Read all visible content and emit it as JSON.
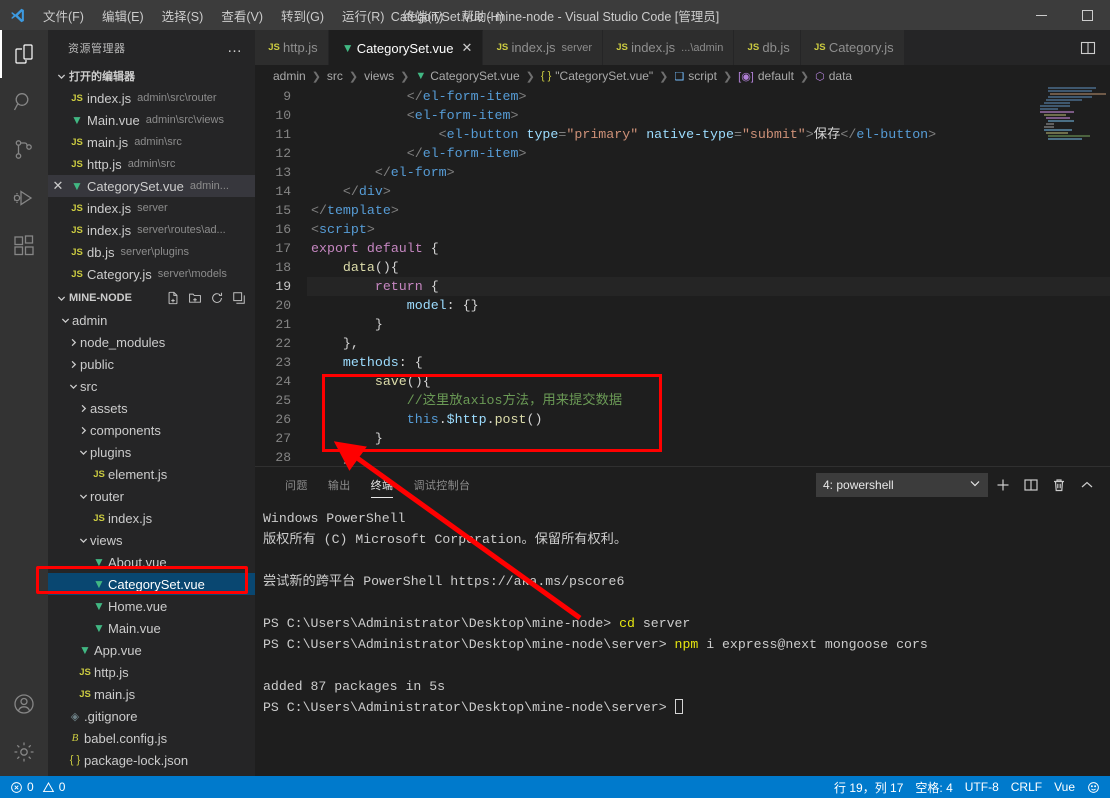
{
  "titlebar": {
    "title": "CategorySet.vue - mine-node - Visual Studio Code [管理员]",
    "menus": [
      {
        "label": "文件(F)",
        "name": "menu-file"
      },
      {
        "label": "编辑(E)",
        "name": "menu-edit"
      },
      {
        "label": "选择(S)",
        "name": "menu-selection"
      },
      {
        "label": "查看(V)",
        "name": "menu-view"
      },
      {
        "label": "转到(G)",
        "name": "menu-goto"
      },
      {
        "label": "运行(R)",
        "name": "menu-run"
      },
      {
        "label": "终端(T)",
        "name": "menu-terminal"
      },
      {
        "label": "帮助(H)",
        "name": "menu-help"
      }
    ],
    "minimize": "—",
    "maximize": "□"
  },
  "activitybar": {
    "items": [
      {
        "name": "explorer-icon",
        "active": true
      },
      {
        "name": "search-icon",
        "active": false
      },
      {
        "name": "source-control-icon",
        "active": false
      },
      {
        "name": "run-debug-icon",
        "active": false
      },
      {
        "name": "extensions-icon",
        "active": false
      }
    ],
    "bottom": [
      {
        "name": "account-icon"
      },
      {
        "name": "settings-gear-icon"
      }
    ]
  },
  "sidebar": {
    "title": "资源管理器",
    "more_label": "…",
    "open_editors": {
      "label": "打开的编辑器",
      "items": [
        {
          "icon": "js",
          "name": "index.js",
          "desc": "admin\\src\\router",
          "active": false
        },
        {
          "icon": "vue",
          "name": "Main.vue",
          "desc": "admin\\src\\views",
          "active": false
        },
        {
          "icon": "js",
          "name": "main.js",
          "desc": "admin\\src",
          "active": false
        },
        {
          "icon": "js",
          "name": "http.js",
          "desc": "admin\\src",
          "active": false
        },
        {
          "icon": "vue",
          "name": "CategorySet.vue",
          "desc": "admin...",
          "active": true
        },
        {
          "icon": "js",
          "name": "index.js",
          "desc": "server",
          "active": false
        },
        {
          "icon": "js",
          "name": "index.js",
          "desc": "server\\routes\\ad...",
          "active": false
        },
        {
          "icon": "js",
          "name": "db.js",
          "desc": "server\\plugins",
          "active": false
        },
        {
          "icon": "js",
          "name": "Category.js",
          "desc": "server\\models",
          "active": false
        }
      ]
    },
    "project": {
      "label": "MINE-NODE",
      "actions": [
        "new-file-icon",
        "new-folder-icon",
        "refresh-icon",
        "collapse-all-icon"
      ],
      "tree": [
        {
          "label": "admin",
          "type": "folder",
          "expanded": true,
          "depth": 1
        },
        {
          "label": "node_modules",
          "type": "folder",
          "expanded": false,
          "depth": 2
        },
        {
          "label": "public",
          "type": "folder",
          "expanded": false,
          "depth": 2
        },
        {
          "label": "src",
          "type": "folder",
          "expanded": true,
          "depth": 2
        },
        {
          "label": "assets",
          "type": "folder",
          "expanded": false,
          "depth": 3
        },
        {
          "label": "components",
          "type": "folder",
          "expanded": false,
          "depth": 3
        },
        {
          "label": "plugins",
          "type": "folder",
          "expanded": true,
          "depth": 3
        },
        {
          "label": "element.js",
          "type": "js",
          "depth": 4
        },
        {
          "label": "router",
          "type": "folder",
          "expanded": true,
          "depth": 3
        },
        {
          "label": "index.js",
          "type": "js",
          "depth": 4
        },
        {
          "label": "views",
          "type": "folder",
          "expanded": true,
          "depth": 3
        },
        {
          "label": "About.vue",
          "type": "vue",
          "depth": 4
        },
        {
          "label": "CategorySet.vue",
          "type": "vue",
          "depth": 4,
          "selected": true
        },
        {
          "label": "Home.vue",
          "type": "vue",
          "depth": 4
        },
        {
          "label": "Main.vue",
          "type": "vue",
          "depth": 4
        },
        {
          "label": "App.vue",
          "type": "vue",
          "depth": 3
        },
        {
          "label": "http.js",
          "type": "js",
          "depth": 3
        },
        {
          "label": "main.js",
          "type": "js",
          "depth": 3
        },
        {
          "label": ".gitignore",
          "type": "git",
          "depth": 2
        },
        {
          "label": "babel.config.js",
          "type": "babel",
          "depth": 2
        },
        {
          "label": "package-lock.json",
          "type": "json",
          "depth": 2
        }
      ]
    }
  },
  "tabs": [
    {
      "icon": "js",
      "label": "http.js",
      "desc": "",
      "active": false,
      "closable": false
    },
    {
      "icon": "vue",
      "label": "CategorySet.vue",
      "desc": "",
      "active": true,
      "closable": true
    },
    {
      "icon": "js",
      "label": "index.js",
      "desc": "server",
      "active": false,
      "closable": false
    },
    {
      "icon": "js",
      "label": "index.js",
      "desc": "...\\admin",
      "active": false,
      "closable": false
    },
    {
      "icon": "js",
      "label": "db.js",
      "desc": "",
      "active": false,
      "closable": false
    },
    {
      "icon": "js",
      "label": "Category.js",
      "desc": "",
      "active": false,
      "closable": false
    }
  ],
  "tabs_actions": [
    {
      "name": "split-editor-icon"
    }
  ],
  "breadcrumbs": [
    {
      "label": "admin",
      "icon": ""
    },
    {
      "label": "src",
      "icon": ""
    },
    {
      "label": "views",
      "icon": ""
    },
    {
      "label": "CategorySet.vue",
      "icon": "vue"
    },
    {
      "label": "\"CategorySet.vue\"",
      "icon": "{}"
    },
    {
      "label": "script",
      "icon": "module"
    },
    {
      "label": "default",
      "icon": "[@]"
    },
    {
      "label": "data",
      "icon": "field"
    }
  ],
  "editor": {
    "first_line": 9,
    "cursor_line": 19,
    "lines": [
      {
        "n": 9,
        "text": "            </el-form-item>"
      },
      {
        "n": 10,
        "text": "            <el-form-item>"
      },
      {
        "n": 11,
        "text": "                <el-button type=\"primary\" native-type=\"submit\">保存</el-button>"
      },
      {
        "n": 12,
        "text": "            </el-form-item>"
      },
      {
        "n": 13,
        "text": "        </el-form>"
      },
      {
        "n": 14,
        "text": "    </div>"
      },
      {
        "n": 15,
        "text": "</template>"
      },
      {
        "n": 16,
        "text": "<script>"
      },
      {
        "n": 17,
        "text": "export default {"
      },
      {
        "n": 18,
        "text": "    data(){"
      },
      {
        "n": 19,
        "text": "        return {"
      },
      {
        "n": 20,
        "text": "            model: {}"
      },
      {
        "n": 21,
        "text": "        }"
      },
      {
        "n": 22,
        "text": "    },"
      },
      {
        "n": 23,
        "text": "    methods: {"
      },
      {
        "n": 24,
        "text": "        save(){"
      },
      {
        "n": 25,
        "text": "            //这里放axios方法，用来提交数据"
      },
      {
        "n": 26,
        "text": "            this.$http.post()"
      },
      {
        "n": 27,
        "text": "        }"
      },
      {
        "n": 28,
        "text": "    }"
      }
    ]
  },
  "panel": {
    "tabs": [
      {
        "label": "问题",
        "active": false
      },
      {
        "label": "输出",
        "active": false
      },
      {
        "label": "终端",
        "active": true
      },
      {
        "label": "调试控制台",
        "active": false
      }
    ],
    "terminal_select": "4: powershell",
    "actions": [
      {
        "name": "new-terminal-icon",
        "glyph": "+"
      },
      {
        "name": "split-terminal-icon",
        "glyph": "⫿⫿"
      },
      {
        "name": "kill-terminal-icon",
        "glyph": "🗑"
      },
      {
        "name": "collapse-panel-icon",
        "glyph": "^"
      }
    ],
    "terminal_lines": [
      "Windows PowerShell",
      "版权所有 (C) Microsoft Corporation。保留所有权利。",
      "",
      "尝试新的跨平台 PowerShell https://aka.ms/pscore6",
      "",
      "PS C:\\Users\\Administrator\\Desktop\\mine-node> cd server",
      "PS C:\\Users\\Administrator\\Desktop\\mine-node\\server> npm i express@next mongoose cors",
      "",
      "added 87 packages in 5s",
      "PS C:\\Users\\Administrator\\Desktop\\mine-node\\server> "
    ]
  },
  "statusbar": {
    "errors": "0",
    "warnings": "0",
    "position": "行 19，列 17",
    "spaces": "空格: 4",
    "encoding": "UTF-8",
    "eol": "CRLF",
    "language": "Vue",
    "feedback": "feedback-smiley-icon"
  },
  "colors": {
    "accent": "#007acc",
    "selection": "#094771",
    "annotation": "#ff0000",
    "vue_green": "#41b883",
    "js_yellow": "#cbcb41"
  }
}
